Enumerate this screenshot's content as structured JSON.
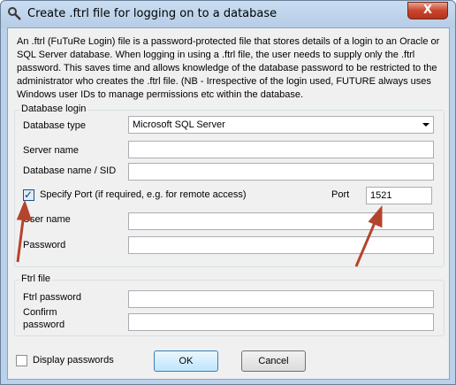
{
  "window": {
    "title": "Create .ftrl file for logging on to a database",
    "close_label": "X"
  },
  "description": "An .ftrl (FuTuRe Login) file is a password-protected file that stores details of a login to an Oracle or SQL Server database. When logging in using a .ftrl file, the user needs to supply only the .ftrl password. This saves time and allows knowledge of the database password to be restricted to the administrator who creates the .ftrl file. (NB - Irrespective of the login used, FUTURE always uses Windows user IDs to manage permissions etc  within the database.",
  "database_login": {
    "group_title": "Database login",
    "database_type_label": "Database type",
    "database_type_value": "Microsoft SQL Server",
    "server_name_label": "Server name",
    "server_name_value": "",
    "database_name_label": "Database name / SID",
    "database_name_value": "",
    "specify_port_label": "Specify Port (if required, e.g. for remote access)",
    "specify_port_checked": true,
    "port_label": "Port",
    "port_value": "1521",
    "user_name_label": "User name",
    "user_name_value": "",
    "password_label": "Password",
    "password_value": ""
  },
  "ftrl_file": {
    "group_title": "Ftrl file",
    "ftrl_password_label": "Ftrl password",
    "ftrl_password_value": "",
    "confirm_password_label_line1": "Confirm",
    "confirm_password_label_line2": "password",
    "confirm_password_value": ""
  },
  "footer": {
    "display_passwords_label": "Display passwords",
    "display_passwords_checked": false,
    "ok_label": "OK",
    "cancel_label": "Cancel"
  },
  "annotation_color": "#b5442c",
  "icons": [
    "app-icon",
    "close-icon",
    "dropdown-arrow-icon",
    "checkmark-icon"
  ]
}
